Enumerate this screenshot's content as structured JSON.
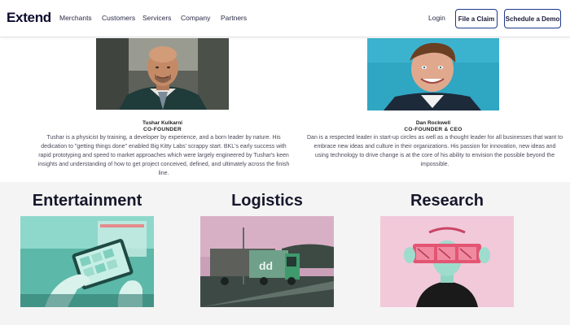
{
  "header": {
    "logo": "Extend",
    "menu": [
      "Merchants",
      "Customers",
      "Servicers",
      "Company",
      "Partners"
    ],
    "login_label": "Login",
    "file_claim_label": "File a Claim",
    "schedule_demo_label": "Schedule a Demo"
  },
  "founders": [
    {
      "name": "Tushar Kulkarni",
      "role": "CO-FOUNDER",
      "bio": "Tushar is a physicist by training, a developer by experience, and a born leader by nature. His dedication to \"getting things done\" enabled Big Kitty Labs' scrappy start. BKL's early success with rapid prototyping and speed to market approaches which were largely engineered by Tushar's keen insights and understanding of how to get project conceived, defined, and ultimately across the finish line."
    },
    {
      "name": "Dan Rockwell",
      "role": "CO-FOUNDER & CEO",
      "bio": "Dan is a respected leader in start-up circles as well as a thought leader for all businesses that want to embrace new ideas and culture in their organizations. His passion for innovation, new ideas and using technology to drive change is at the core of his ability to envision the possible beyond the impossible."
    }
  ],
  "verticals": [
    {
      "title": "Entertainment"
    },
    {
      "title": "Logistics"
    },
    {
      "title": "Research"
    }
  ],
  "colors": {
    "button_border": "#1e3a8a",
    "section_bg": "#f4f4f4",
    "dan_photo_bg": "#2fa6c2"
  }
}
